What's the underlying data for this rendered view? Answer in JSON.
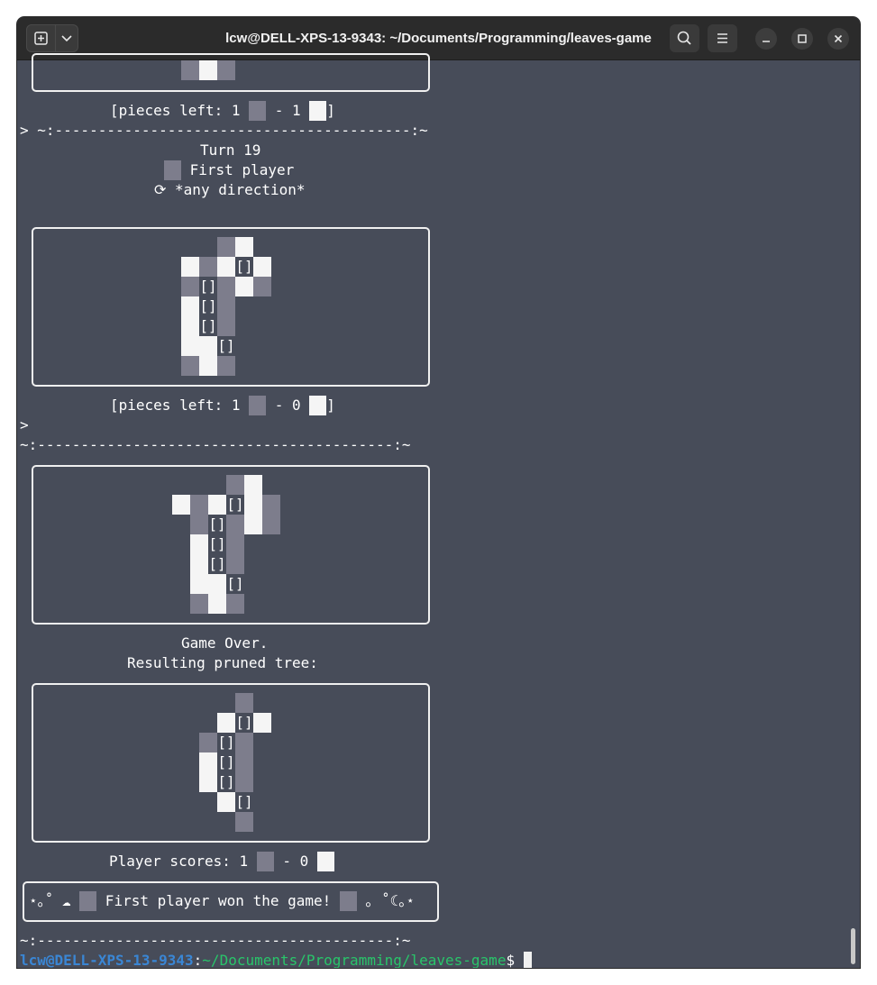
{
  "window": {
    "title": "lcw@DELL-XPS-13-9343: ~/Documents/Programming/leaves-game",
    "icons": [
      "new-tab-icon",
      "chevron-down-icon",
      "search-icon",
      "hamburger-menu-icon",
      "minimize-icon",
      "maximize-icon",
      "close-icon"
    ]
  },
  "colors": {
    "background": "#474c59",
    "titlebar": "#2b2b2b",
    "dark_piece": "#7d7d8c",
    "light_piece": "#f5f5f5",
    "prompt_user": "#3a86d4",
    "prompt_path": "#29c46a"
  },
  "terminal": {
    "pieces_left_1": {
      "prefix": "[pieces left: 1 ",
      "mid": " - 1 ",
      "suffix": "]"
    },
    "separator_1": "> ~:-----------------------------------------:~",
    "turn": "Turn 19",
    "player": "First player",
    "direction": "⟳ *any direction*",
    "selection_marker": "[]",
    "pieces_left_2": {
      "prefix": "[pieces left: 1 ",
      "mid": " - 0 ",
      "suffix": "]"
    },
    "prompt_symbol": ">",
    "separator_2": "~:-----------------------------------------:~",
    "game_over": "Game Over.",
    "pruned_title": "Resulting pruned tree:",
    "scores": {
      "prefix": "Player scores: 1 ",
      "mid": " - 0 "
    },
    "winner": {
      "prefix": "⋆｡˚ ☁ ",
      "text": " First player won the game! ",
      "suffix": " ｡ ˚☾｡⋆"
    },
    "separator_3": "~:-----------------------------------------:~",
    "prompt": {
      "user": "lcw@DELL-XPS-13-9343",
      "colon": ":",
      "path": "~/Documents/Programming/leaves-game",
      "dollar": "$ "
    }
  }
}
